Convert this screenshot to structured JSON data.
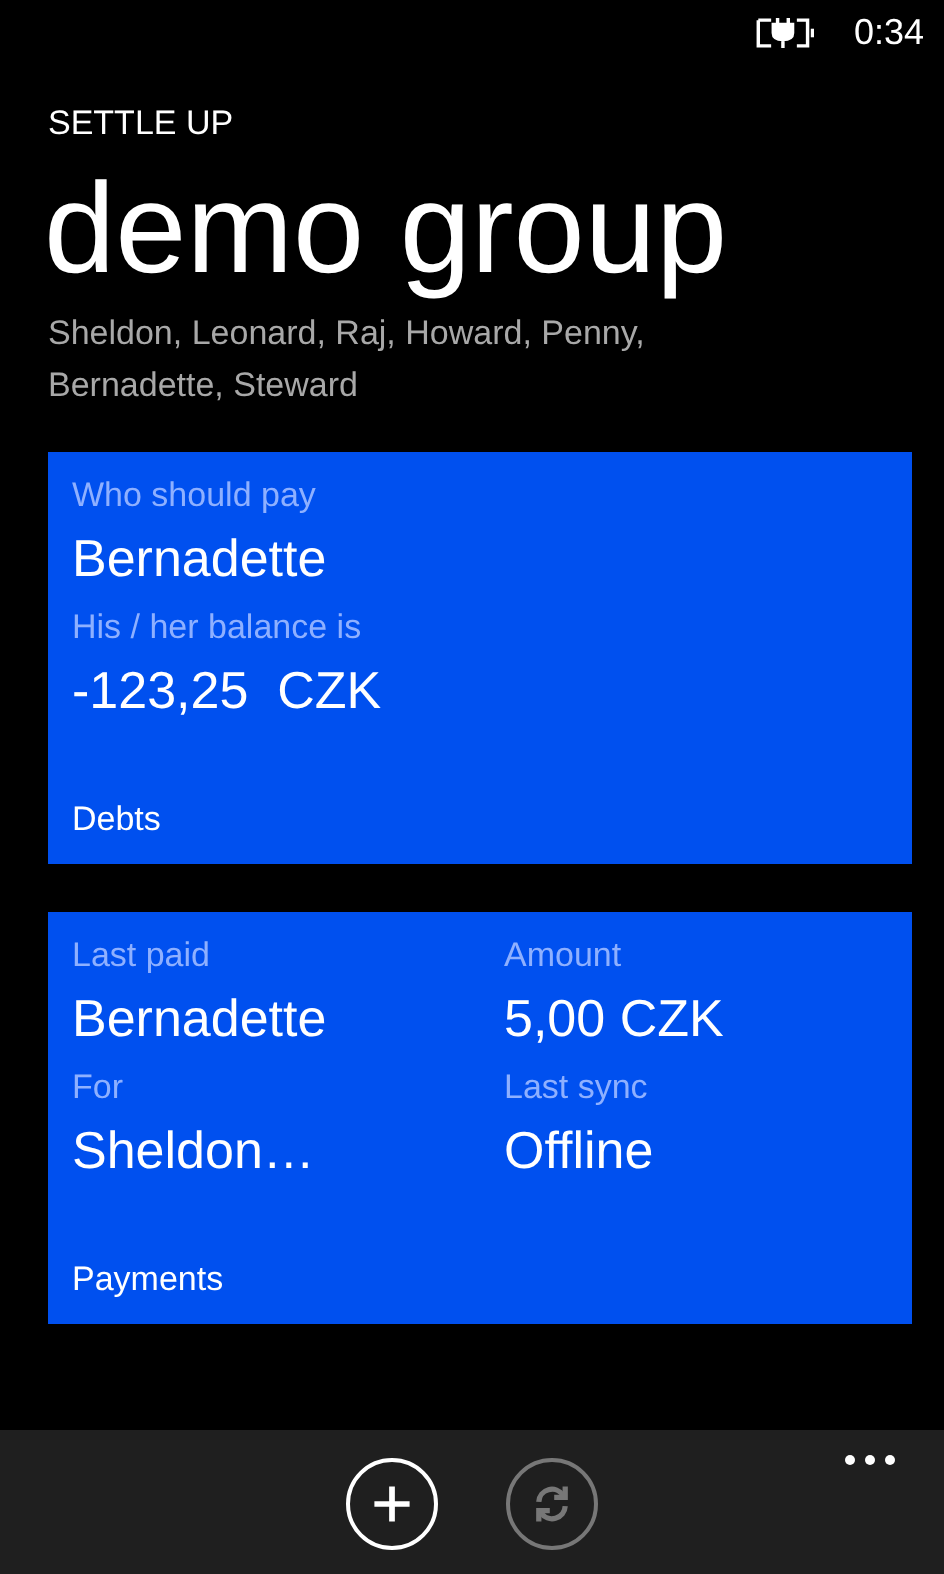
{
  "status_bar": {
    "time": "0:34"
  },
  "app_name": "SETTLE UP",
  "group": {
    "title": "demo group",
    "members": "Sheldon, Leonard, Raj, Howard, Penny, Bernadette, Steward"
  },
  "tiles": [
    {
      "kind": "single",
      "title": "Debts",
      "fields": [
        {
          "label": "Who should pay",
          "value": "Bernadette"
        },
        {
          "label": "His / her balance is",
          "value": "-123,25  CZK"
        }
      ]
    },
    {
      "kind": "grid",
      "title": "Payments",
      "fields": [
        {
          "label": "Last paid",
          "value": "Bernadette"
        },
        {
          "label": "Amount",
          "value": "5,00 CZK"
        },
        {
          "label": "For",
          "value": "Sheldon…"
        },
        {
          "label": "Last sync",
          "value": "Offline"
        }
      ]
    }
  ],
  "app_bar": {
    "buttons": [
      {
        "kind": "add",
        "disabled": false
      },
      {
        "kind": "sync",
        "disabled": true
      }
    ]
  }
}
